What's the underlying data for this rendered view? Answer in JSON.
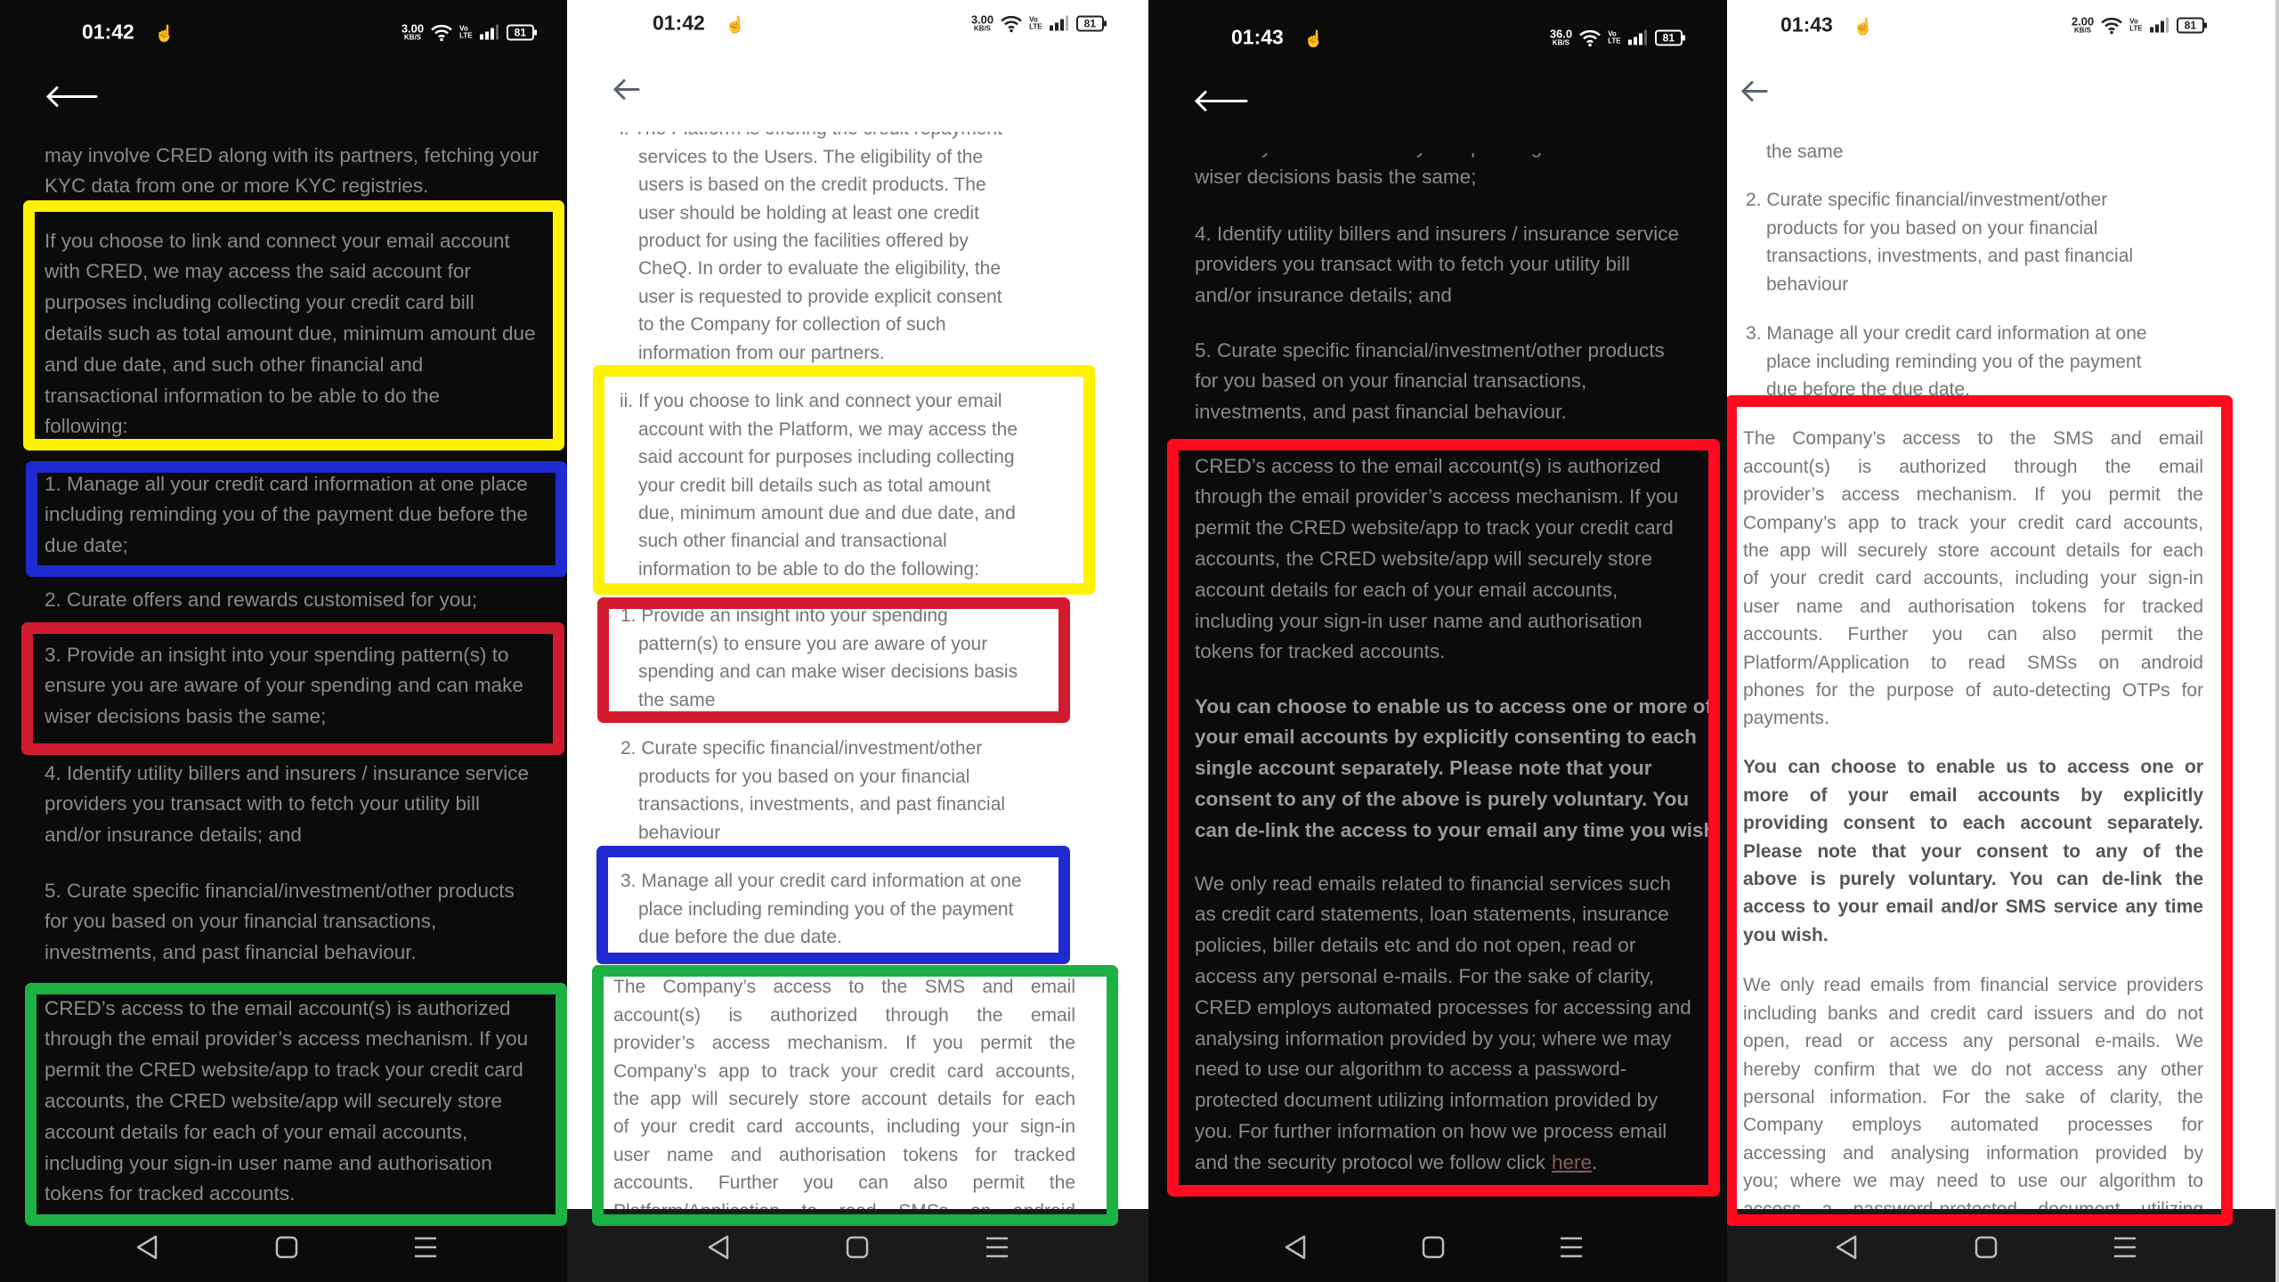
{
  "colors": {
    "yellow": "#fff200",
    "blue": "#1f2bd1",
    "red": "#d31b2f",
    "green": "#1db043",
    "bright_red": "#ff0a1e"
  },
  "icons": {
    "back": "arrow-left-icon",
    "wifi": "wifi-icon",
    "signal": "signal-bars-icon",
    "battery": "battery-icon",
    "touch": "touch-hand-icon",
    "nav_back": "triangle-back-icon",
    "nav_home": "square-home-icon",
    "nav_menu": "menu-lines-icon"
  },
  "panels": [
    {
      "time": "01:42",
      "speed": "3.00",
      "speed_unit": "KB/S",
      "volte": [
        "Vo",
        "LTE"
      ],
      "battery": "81",
      "blocks": [
        [
          "may involve CRED along with its partners, fetching your",
          "KYC data from one or more KYC registries."
        ],
        [
          "If you choose to link and connect your email account",
          "with CRED, we may access the said account for",
          "purposes including collecting your credit card bill",
          "details such as total amount due, minimum amount due",
          "and due date, and such other financial and",
          "transactional information to be able to do the",
          "following:"
        ],
        [
          "1. Manage all your credit card information at one place",
          "including reminding you of the payment due before the",
          "due date;"
        ],
        [
          "2. Curate offers and rewards customised for you;"
        ],
        [
          "3. Provide an insight into your spending pattern(s) to",
          "ensure you are aware of your spending and can make",
          "wiser decisions basis the same;"
        ],
        [
          "4. Identify utility billers and insurers / insurance service",
          "providers you transact with to fetch your utility bill",
          "and/or insurance details; and"
        ],
        [
          "5. Curate specific financial/investment/other products",
          "for you based on your financial transactions,",
          "investments, and past financial behaviour."
        ],
        [
          "CRED’s access to the email account(s) is authorized",
          "through the email provider’s access mechanism. If you",
          "permit the CRED website/app to track your credit card",
          "accounts, the CRED website/app will securely store",
          "account details for each of your email accounts,",
          "including your sign-in user name and authorisation",
          "tokens for tracked accounts."
        ]
      ]
    },
    {
      "time": "01:42",
      "speed": "3.00",
      "speed_unit": "KB/S",
      "volte": [
        "Vo",
        "LTE"
      ],
      "battery": "81",
      "blocks": [
        [
          "i. The Platform is offering the credit repayment",
          "services to the Users. The eligibility of the",
          "users is based on the credit products. The",
          "user should be holding at least one credit",
          "product for using the facilities offered by",
          "CheQ. In order to evaluate the eligibility, the",
          "user is requested to provide explicit consent",
          "to the Company for collection of such",
          "information from our partners."
        ],
        [
          "ii. If you choose to link and connect your email",
          "account with the Platform, we may access the",
          "said account for purposes including collecting",
          "your credit bill details such as total amount",
          "due, minimum amount due and due date, and",
          "such other financial and transactional",
          "information to be able to do the following:"
        ],
        [
          "1. Provide an insight into your spending",
          "pattern(s) to ensure you are aware of your",
          "spending and can make wiser decisions basis",
          "the same"
        ],
        [
          "2. Curate specific financial/investment/other",
          "products for you based on your financial",
          "transactions, investments, and past financial",
          "behaviour"
        ],
        [
          "3. Manage all your credit card information at one",
          "place including reminding you of the payment",
          "due before the due date."
        ],
        [
          "The Company’s access to the SMS and email",
          "account(s) is authorized through the email",
          "provider’s access mechanism. If you permit the",
          "Company’s app to track your credit card accounts,",
          "the app will securely store account details for each",
          "of your credit card accounts, including your sign-in",
          "user name and authorisation tokens for tracked",
          "accounts. Further you can also permit the",
          "Platform/Application to read SMSs on android"
        ]
      ]
    },
    {
      "time": "01:43",
      "speed": "36.0",
      "speed_unit": "KB/S",
      "volte": [
        "Vo",
        "LTE"
      ],
      "battery": "81",
      "link_text": "here",
      "link_suffix": ".",
      "blocks": [
        [
          "ensure you are aware of your spending and can make",
          "wiser decisions basis the same;"
        ],
        [
          "4. Identify utility billers and insurers / insurance service",
          "providers you transact with to fetch your utility bill",
          "and/or insurance details; and"
        ],
        [
          "5. Curate specific financial/investment/other products",
          "for you based on your financial transactions,",
          "investments, and past financial behaviour."
        ],
        [
          "CRED’s access to the email account(s) is authorized",
          "through the email provider’s access mechanism. If you",
          "permit the CRED website/app to track your credit card",
          "accounts, the CRED website/app will securely store",
          "account details for each of your email accounts,",
          "including your sign-in user name and authorisation",
          "tokens for tracked accounts."
        ],
        [
          "You can choose to enable us to access one or more of",
          "your email accounts by explicitly consenting to each",
          "single account separately. Please note that your",
          "consent to any of the above is purely voluntary. You",
          "can de-link the access to your email any time you wish."
        ],
        [
          "We only read emails related to financial services such",
          "as credit card statements, loan statements, insurance",
          "policies, biller details etc and do not open, read or",
          "access any personal e-mails. For the sake of clarity,",
          "CRED employs automated processes for accessing and",
          "analysing information provided by you; where we may",
          "need to use our algorithm to access a password-",
          "protected document utilizing information provided by",
          "you. For further information on how we process email",
          "and the security protocol we follow click"
        ]
      ]
    },
    {
      "time": "01:43",
      "speed": "2.00",
      "speed_unit": "KB/S",
      "volte": [
        "Vo",
        "LTE"
      ],
      "battery": "81",
      "blocks": [
        [
          "the same"
        ],
        [
          "2. Curate specific financial/investment/other",
          "products for you based on your financial",
          "transactions, investments, and past financial",
          "behaviour"
        ],
        [
          "3. Manage all your credit card information at one",
          "place including reminding you of the payment",
          "due before the due date."
        ],
        [
          "The Company’s access to the SMS and email",
          "account(s) is authorized through the email",
          "provider’s access mechanism. If you permit the",
          "Company’s app to track your credit card accounts,",
          "the app will securely store account details for each",
          "of your credit card accounts, including your sign-in",
          "user name and authorisation tokens for tracked",
          "accounts. Further you can also permit the",
          "Platform/Application to read SMSs on android",
          "phones for the purpose of auto-detecting OTPs for",
          "payments."
        ],
        [
          "You can choose to enable us to access one or",
          "more of your email accounts by explicitly",
          "providing consent to each account separately.",
          "Please note that your consent to any of the",
          "above is purely voluntary. You can de-link the",
          "access to your email and/or SMS service any time",
          "you wish."
        ],
        [
          "We only read emails from financial service providers",
          "including banks and credit card issuers and do not",
          "open, read or access any personal e-mails. We",
          "hereby confirm that we do not access any other",
          "personal information. For the sake of clarity, the",
          "Company employs automated processes for",
          "accessing and analysing information provided by",
          "you; where we may need to use our algorithm to",
          "access a password-protected document utilizing"
        ]
      ]
    }
  ]
}
